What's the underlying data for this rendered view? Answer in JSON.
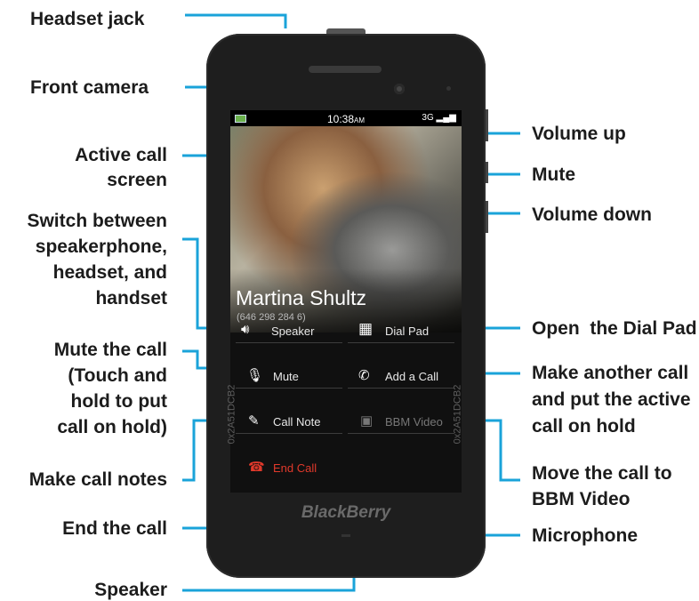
{
  "labels": {
    "headset_jack": "Headset jack",
    "front_camera": "Front camera",
    "active_call_screen_1": "Active call",
    "active_call_screen_2": "screen",
    "switch_1": "Switch between",
    "switch_2": "speakerphone,",
    "switch_3": "headset, and",
    "switch_4": "handset",
    "mute_call_1": "Mute the call",
    "mute_call_2": "(Touch and",
    "mute_call_3": "hold to put",
    "mute_call_4": "call on hold)",
    "make_call_notes": "Make call notes",
    "end_the_call": "End the call",
    "speaker": "Speaker",
    "volume_up": "Volume up",
    "mute": "Mute",
    "volume_down": "Volume down",
    "open_dial_pad": "Open  the Dial Pad",
    "make_another_1": "Make another call",
    "make_another_2": "and put the active",
    "make_another_3": "call on hold",
    "move_bbm_1": "Move the call to",
    "move_bbm_2": "BBM Video",
    "microphone": "Microphone"
  },
  "phone": {
    "status_time": "10:38",
    "status_ampm": "AM",
    "status_network": "3G",
    "caller_name": "Martina Shultz",
    "caller_number": "(646 298 284 6)",
    "pin_left": "0x2A51DCB2",
    "pin_right": "0x2A51DCB2",
    "brand": "BlackBerry",
    "buttons": {
      "speaker": "Speaker",
      "dial_pad": "Dial Pad",
      "mute": "Mute",
      "add_call": "Add a Call",
      "call_note": "Call Note",
      "bbm_video": "BBM Video",
      "end_call": "End Call"
    },
    "icons": {
      "speaker": "speaker-icon",
      "dial_pad": "dial-pad-icon",
      "mute": "mute-icon",
      "add_call": "add-call-icon",
      "call_note": "call-note-icon",
      "bbm_video": "bbm-video-icon",
      "end_call": "end-call-icon"
    }
  },
  "colors": {
    "callout_line": "#1aa3d9",
    "end_call": "#e0392b",
    "phone_body": "#1e1e1e"
  }
}
